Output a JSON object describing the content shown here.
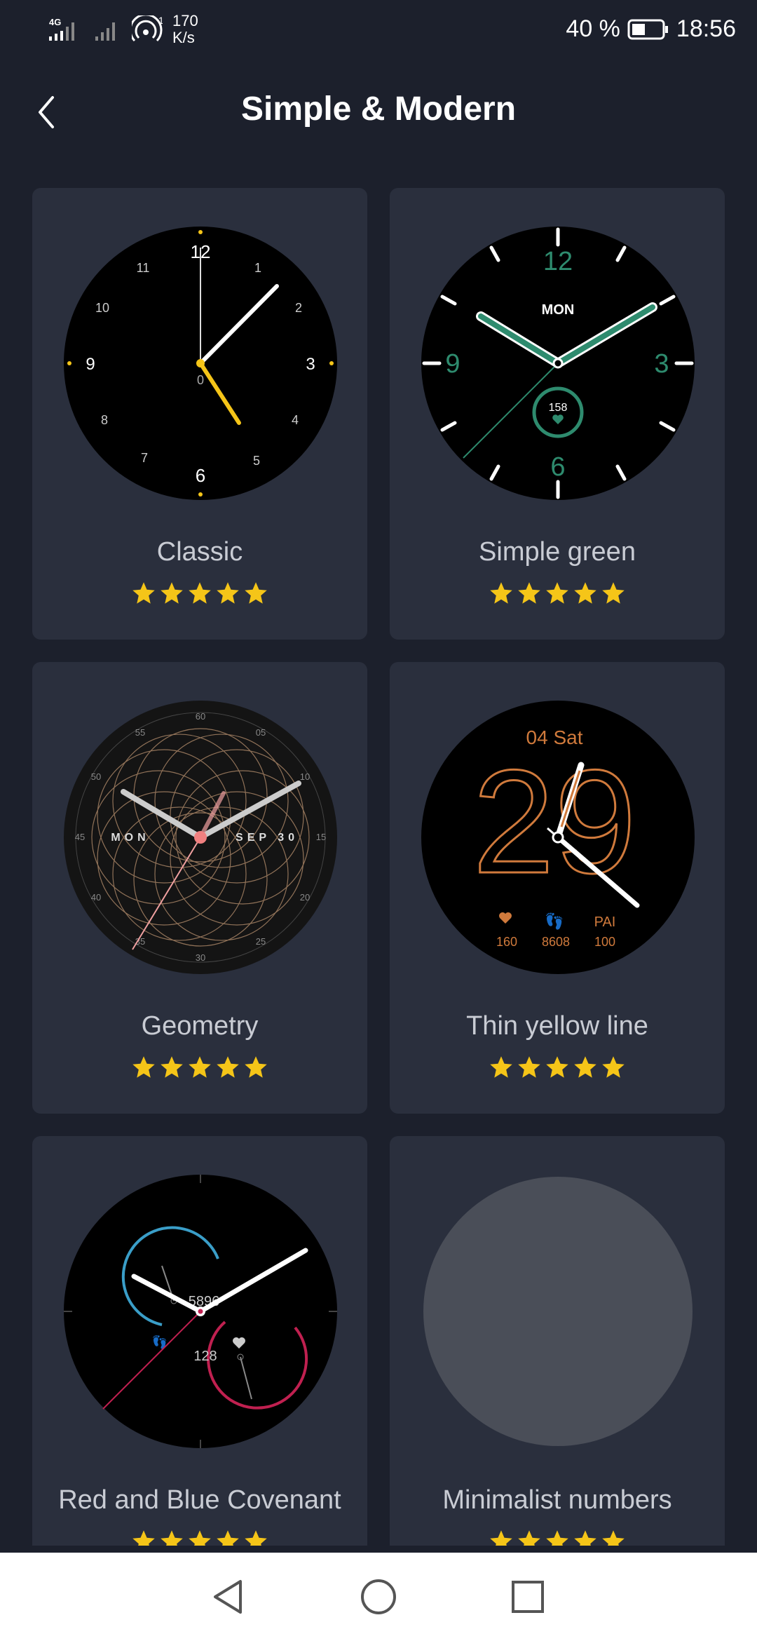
{
  "status_bar": {
    "network_type": "4G",
    "wifi_badge": "1",
    "speed_value": "170",
    "speed_unit": "K/s",
    "battery_percent": "40 %",
    "time": "18:56"
  },
  "header": {
    "title": "Simple & Modern",
    "back_icon": "chevron-left-icon"
  },
  "watch_faces": [
    {
      "name": "Classic",
      "rating": 5
    },
    {
      "name": "Simple green",
      "rating": 5
    },
    {
      "name": "Geometry",
      "rating": 5
    },
    {
      "name": "Thin yellow line",
      "rating": 5
    },
    {
      "name": "Red and Blue Covenant",
      "rating": 5
    },
    {
      "name": "Minimalist numbers",
      "rating": 5
    }
  ],
  "faces": {
    "classic": {
      "numbers": [
        "12",
        "1",
        "2",
        "3",
        "4",
        "5",
        "6",
        "7",
        "8",
        "9",
        "10",
        "11"
      ],
      "center": "0"
    },
    "simple_green": {
      "numbers": [
        "12",
        "3",
        "6",
        "9"
      ],
      "day": "MON",
      "heart_rate": "158"
    },
    "geometry": {
      "day": "MON",
      "date": "SEP 30",
      "ring": [
        "60",
        "05",
        "10",
        "15",
        "20",
        "25",
        "30",
        "35",
        "40",
        "45",
        "50",
        "55"
      ]
    },
    "thin_yellow": {
      "date": "04 Sat",
      "big_number": "29",
      "heart": "160",
      "steps": "8608",
      "pai_label": "PAI",
      "pai": "100"
    },
    "covenant": {
      "steps": "5896",
      "heart": "128"
    }
  },
  "nav": {
    "back": "triangle-back-icon",
    "home": "circle-home-icon",
    "recent": "square-recent-icon"
  },
  "colors": {
    "background": "#1c202c",
    "card": "#2a2f3d",
    "star": "#f5c518",
    "green": "#2e8b6e",
    "orange": "#d07a3c",
    "pink": "#f0a0a0"
  }
}
